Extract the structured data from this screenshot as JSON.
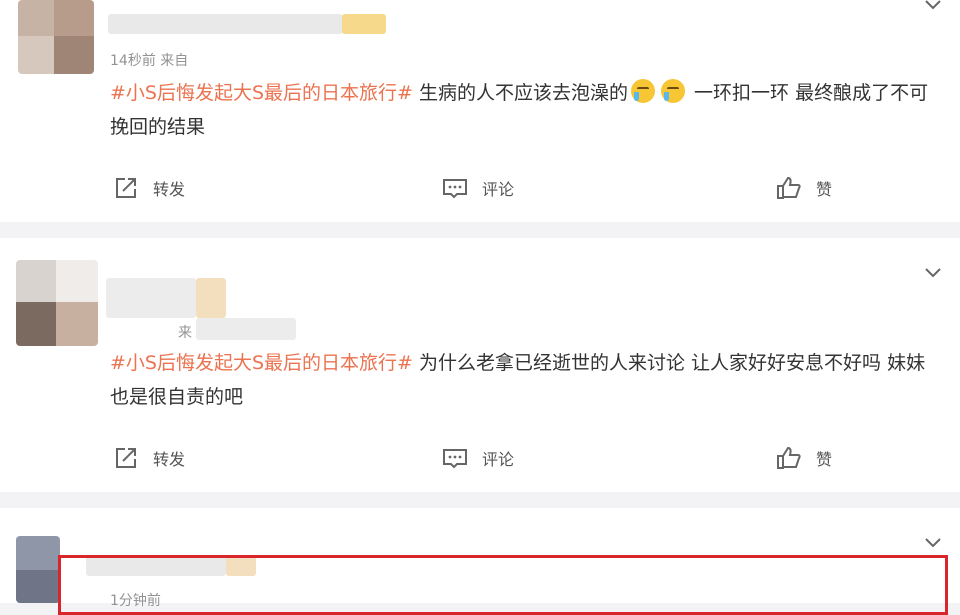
{
  "posts": [
    {
      "meta": "14秒前  来自",
      "topic": "#小S后悔发起大S最后的日本旅行#",
      "text_part1": " 生病的人不应该去泡澡的",
      "text_part2": " 一环扣一环 最终酿成了不可挽回的结果",
      "emoji": "crying-face",
      "actions": {
        "repost": "转发",
        "comment": "评论",
        "like": "赞"
      }
    },
    {
      "meta": "来",
      "topic": "#小S后悔发起大S最后的日本旅行#",
      "text_part1": " 为什么老拿已经逝世的人来讨论 让人家好好安息不好吗 妹妹也是很自责的吧",
      "actions": {
        "repost": "转发",
        "comment": "评论",
        "like": "赞"
      }
    },
    {
      "meta": "1分钟前"
    }
  ],
  "colors": {
    "topic": "#eb7350",
    "highlight": "#d9262c",
    "separator": "#f3f3f5"
  },
  "icons": [
    "chevron-down-icon",
    "share-icon",
    "comment-icon",
    "thumbs-up-icon",
    "crying-face-emoji"
  ]
}
